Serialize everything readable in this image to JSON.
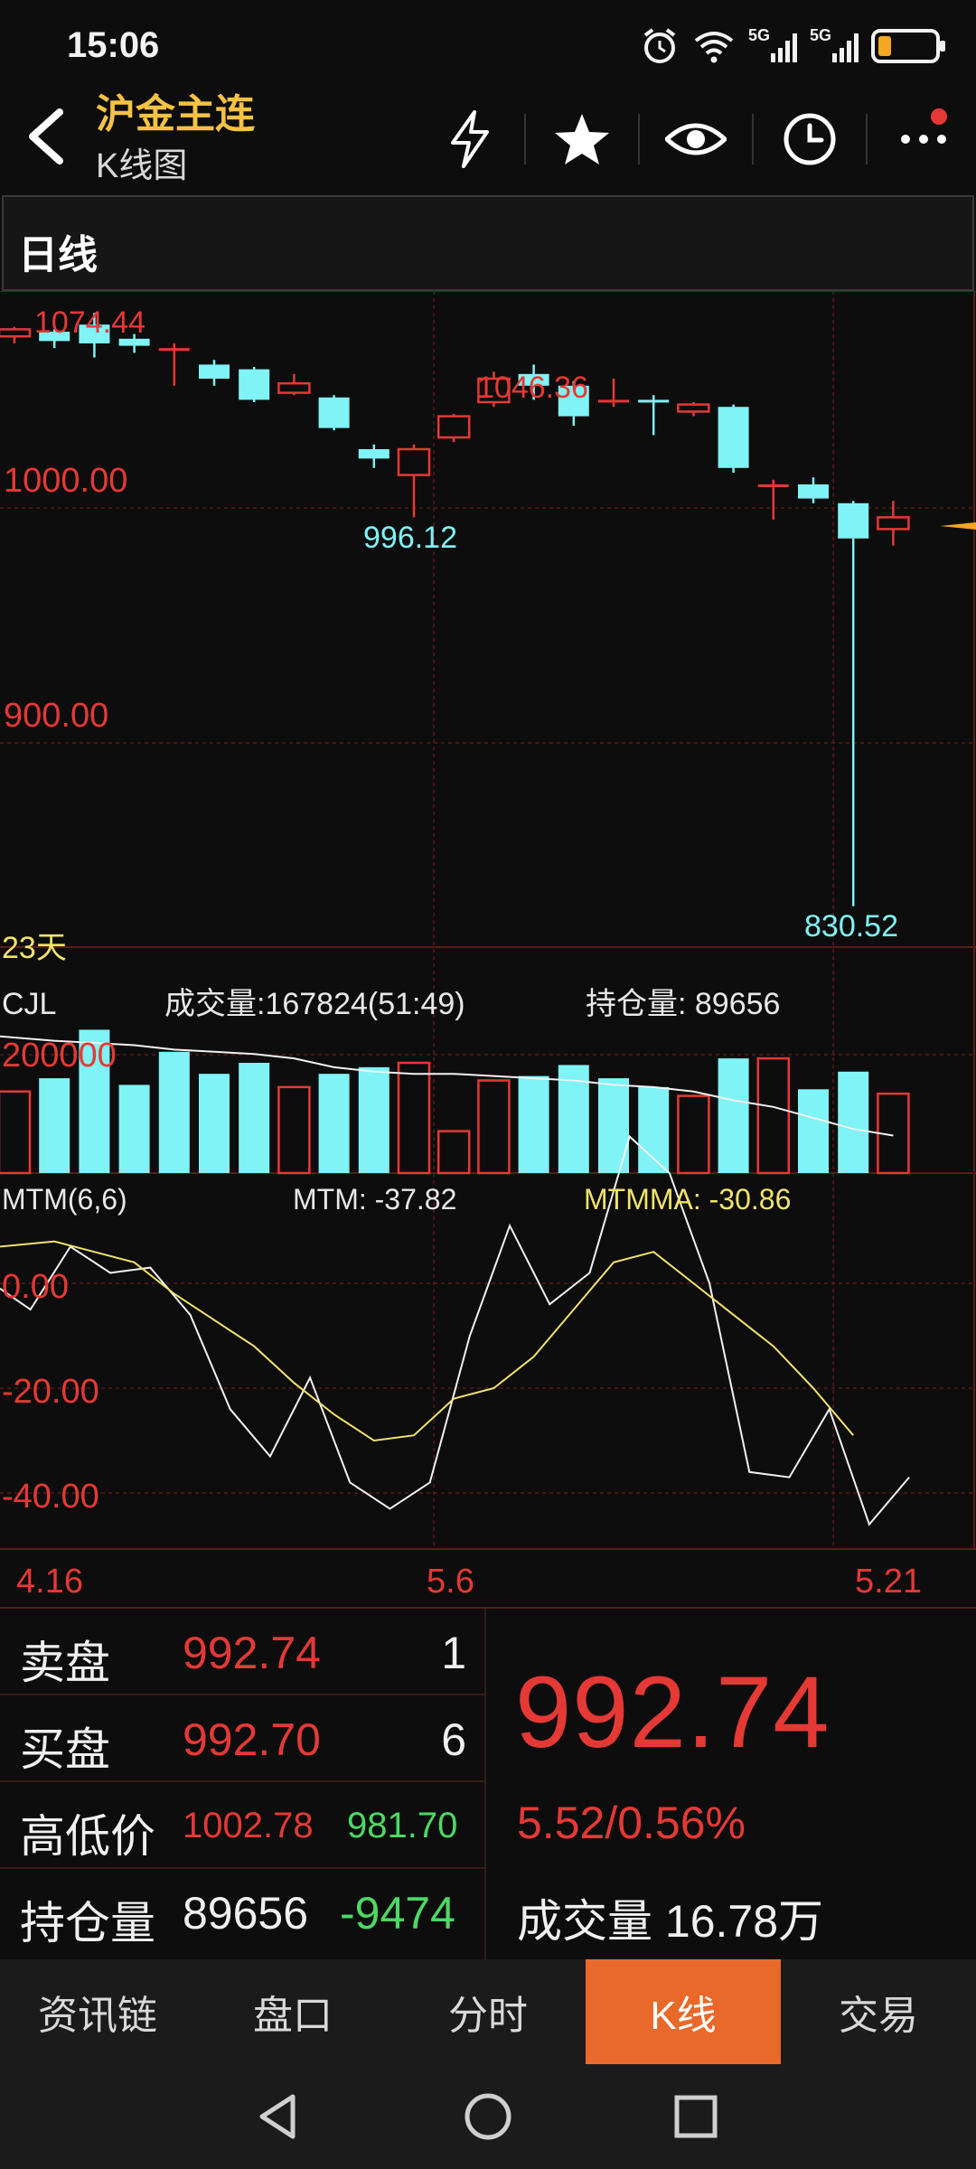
{
  "status_bar": {
    "time": "15:06",
    "signal1_label": "5G",
    "signal2_label": "5G",
    "icons": [
      "alarm-icon",
      "wifi-icon",
      "signal-icon",
      "signal-icon",
      "battery-icon"
    ]
  },
  "header": {
    "title": "沪金主连",
    "subtitle": "K线图",
    "icons": [
      "back-icon",
      "lightning-icon",
      "star-icon",
      "eye-icon",
      "clock-icon",
      "more-icon"
    ]
  },
  "period": {
    "label": "日线"
  },
  "chart": {
    "price_panel": {
      "y_labels": [
        "1000.00",
        "900.00"
      ],
      "annotations": {
        "high": "1074.44",
        "high2": "1046.36",
        "low": "996.12",
        "low2": "830.52"
      },
      "range_label": "23天"
    },
    "volume_panel": {
      "title": "CJL",
      "volume_text": "成交量:167824(51:49)",
      "open_interest_text": "持仓量: 89656",
      "y_label": "200000"
    },
    "mtm_panel": {
      "title": "MTM(6,6)",
      "mtm_text": "MTM: -37.82",
      "mtmma_text": "MTMMA: -30.86",
      "y_labels": [
        "0.00",
        "-20.00",
        "-40.00"
      ]
    },
    "x_labels": [
      "4.16",
      "5.6",
      "5.21"
    ],
    "colors": {
      "up": "#e53935",
      "down": "#7ff3f5",
      "ma_line": "#f2f2f2",
      "mtmma_line": "#f2e36b",
      "grid": "#5a1a1a"
    }
  },
  "chart_data": {
    "type": "candlestick",
    "candles": [
      {
        "o": 1073,
        "c": 1076,
        "h": 1077,
        "l": 1070
      },
      {
        "o": 1075,
        "c": 1071,
        "h": 1076,
        "l": 1068
      },
      {
        "o": 1078,
        "c": 1070,
        "h": 1083,
        "l": 1064
      },
      {
        "o": 1072,
        "c": 1069,
        "h": 1074,
        "l": 1066
      },
      {
        "o": 1068,
        "c": 1068,
        "h": 1070,
        "l": 1052
      },
      {
        "o": 1061,
        "c": 1055,
        "h": 1063,
        "l": 1052
      },
      {
        "o": 1059,
        "c": 1046,
        "h": 1060,
        "l": 1045
      },
      {
        "o": 1049,
        "c": 1053,
        "h": 1057,
        "l": 1048
      },
      {
        "o": 1047,
        "c": 1034,
        "h": 1048,
        "l": 1033
      },
      {
        "o": 1025,
        "c": 1021,
        "h": 1027,
        "l": 1017
      },
      {
        "o": 1014,
        "c": 1025,
        "h": 1027,
        "l": 996
      },
      {
        "o": 1030,
        "c": 1039,
        "h": 1040,
        "l": 1028
      },
      {
        "o": 1045,
        "c": 1055,
        "h": 1058,
        "l": 1043
      },
      {
        "o": 1057,
        "c": 1052,
        "h": 1061,
        "l": 1046
      },
      {
        "o": 1052,
        "c": 1039,
        "h": 1054,
        "l": 1035
      },
      {
        "o": 1046,
        "c": 1046,
        "h": 1055,
        "l": 1043
      },
      {
        "o": 1046,
        "c": 1045,
        "h": 1048,
        "l": 1031
      },
      {
        "o": 1041,
        "c": 1044,
        "h": 1045,
        "l": 1039
      },
      {
        "o": 1043,
        "c": 1017,
        "h": 1044,
        "l": 1015
      },
      {
        "o": 1010,
        "c": 1010,
        "h": 1012,
        "l": 995
      },
      {
        "o": 1010,
        "c": 1004,
        "h": 1013,
        "l": 1002
      },
      {
        "o": 1002,
        "c": 987,
        "h": 1003,
        "l": 830.52
      },
      {
        "o": 991,
        "c": 996,
        "h": 1003,
        "l": 984
      }
    ],
    "volume": [
      {
        "v": 37,
        "up": true
      },
      {
        "v": 43,
        "up": false
      },
      {
        "v": 65,
        "up": false
      },
      {
        "v": 40,
        "up": false
      },
      {
        "v": 55,
        "up": false
      },
      {
        "v": 45,
        "up": false
      },
      {
        "v": 50,
        "up": false
      },
      {
        "v": 39,
        "up": true
      },
      {
        "v": 45,
        "up": false
      },
      {
        "v": 48,
        "up": false
      },
      {
        "v": 50,
        "up": true
      },
      {
        "v": 19,
        "up": true
      },
      {
        "v": 42,
        "up": true
      },
      {
        "v": 44,
        "up": false
      },
      {
        "v": 49,
        "up": false
      },
      {
        "v": 43,
        "up": false
      },
      {
        "v": 39,
        "up": false
      },
      {
        "v": 35,
        "up": true
      },
      {
        "v": 52,
        "up": false
      },
      {
        "v": 52,
        "up": true
      },
      {
        "v": 38,
        "up": false
      },
      {
        "v": 46,
        "up": false
      },
      {
        "v": 36,
        "up": true
      }
    ],
    "volume_ma": [
      62,
      60,
      59,
      58,
      56,
      55,
      54,
      52,
      48,
      46,
      45,
      45,
      44,
      43,
      42,
      40,
      39,
      37,
      33,
      30,
      25,
      20,
      17
    ],
    "mtm": [
      -1,
      -5,
      7,
      2,
      3,
      -6,
      -24,
      -33,
      -18,
      -38,
      -43,
      -38,
      -10,
      11,
      -4,
      2,
      28,
      21,
      0,
      -36,
      -37,
      -24,
      -46,
      -37
    ],
    "mtmma": [
      7,
      8,
      6,
      4,
      -2,
      -7,
      -12,
      -19,
      -25,
      -30,
      -29,
      -22,
      -20,
      -14,
      -5,
      4,
      6,
      0,
      -6,
      -12,
      -20,
      -29
    ],
    "ylim_price": [
      820,
      1090
    ],
    "ylim_mtm": [
      -50,
      30
    ]
  },
  "quote": {
    "ask_label": "卖盘",
    "ask_price": "992.74",
    "ask_vol": "1",
    "bid_label": "买盘",
    "bid_price": "992.70",
    "bid_vol": "6",
    "hl_label": "高低价",
    "high": "1002.78",
    "low": "981.70",
    "oi_label": "持仓量",
    "oi": "89656",
    "oi_change": "-9474",
    "last_price": "992.74",
    "change": "5.52/0.56%",
    "volume_label": "成交量 16.78万"
  },
  "tabs": [
    {
      "label": "资讯链",
      "active": false
    },
    {
      "label": "盘口",
      "active": false
    },
    {
      "label": "分时",
      "active": false
    },
    {
      "label": "K线",
      "active": true
    },
    {
      "label": "交易",
      "active": false
    }
  ],
  "nav": [
    "back-triangle-icon",
    "home-circle-icon",
    "recents-square-icon"
  ]
}
